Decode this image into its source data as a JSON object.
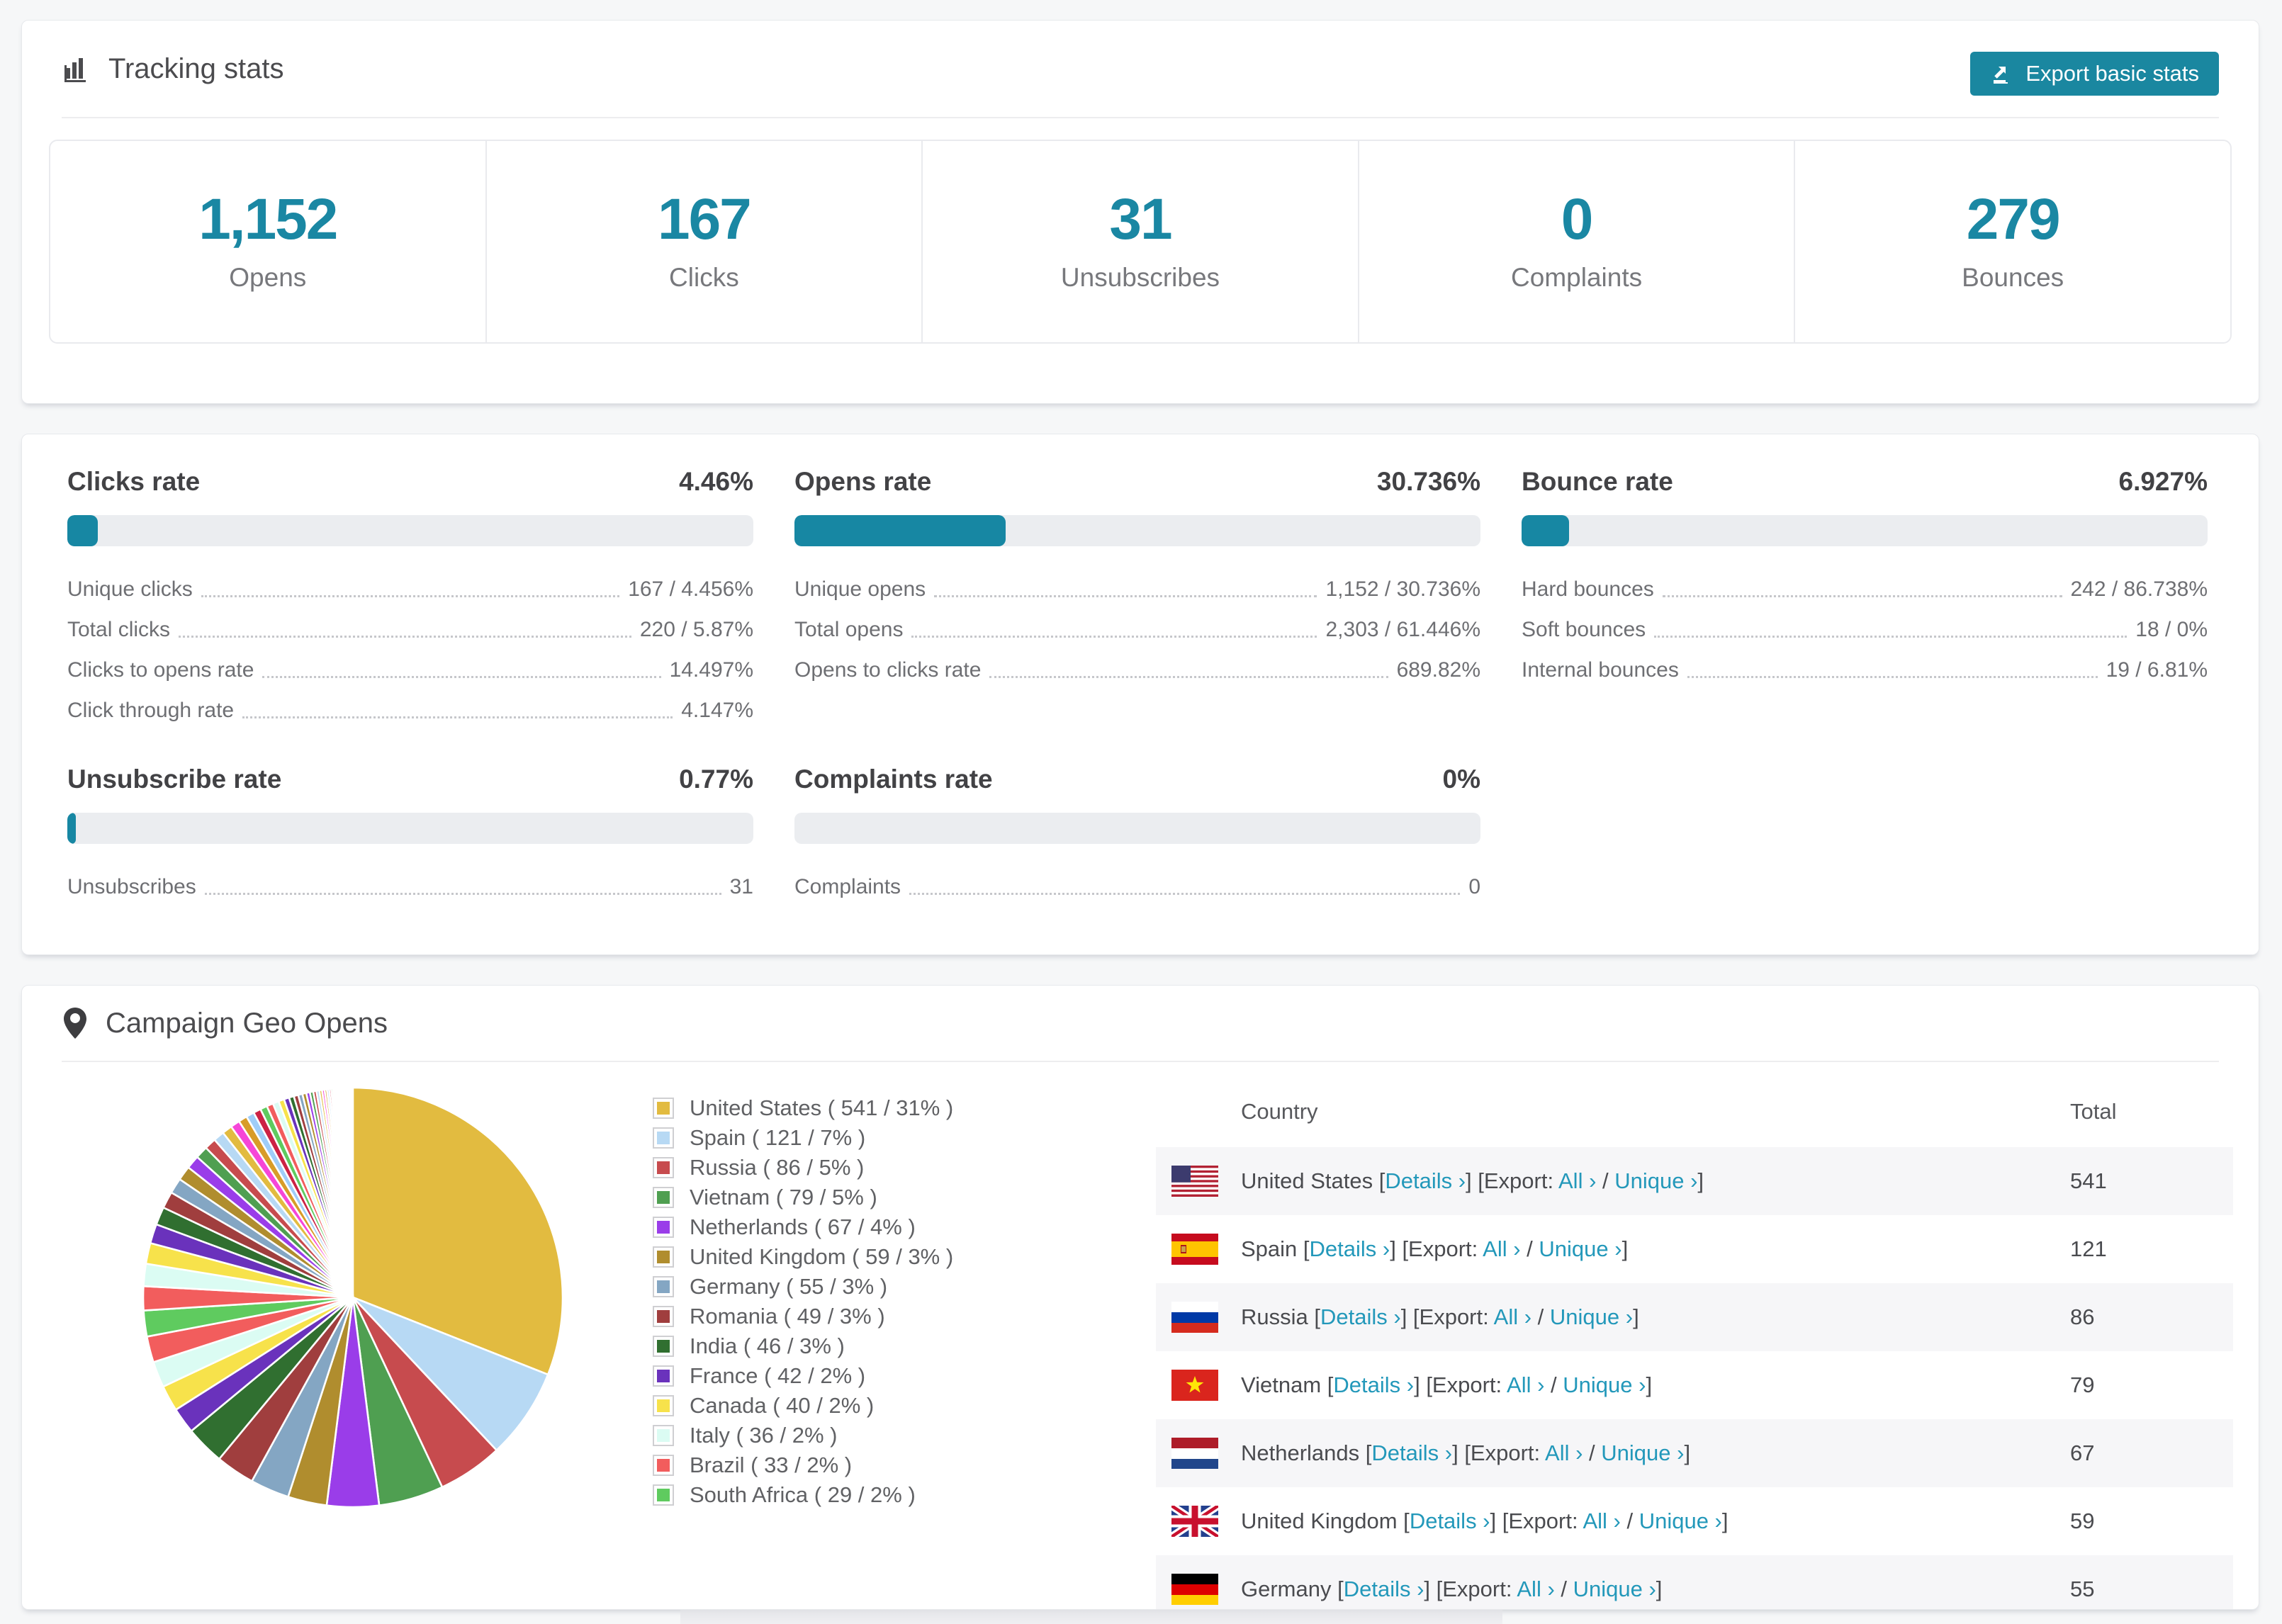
{
  "page": {
    "background": "#f6f7f8",
    "accent": "#1a87a0",
    "link_color": "#2398ba"
  },
  "tracking": {
    "title": "Tracking stats",
    "title_icon": "bar-chart-icon",
    "export_button": {
      "label": "Export basic stats",
      "icon": "export-icon",
      "bg": "#1a87a0"
    },
    "stats": [
      {
        "value": "1,152",
        "label": "Opens"
      },
      {
        "value": "167",
        "label": "Clicks"
      },
      {
        "value": "31",
        "label": "Unsubscribes"
      },
      {
        "value": "0",
        "label": "Complaints"
      },
      {
        "value": "279",
        "label": "Bounces"
      }
    ]
  },
  "rates": {
    "sections": [
      {
        "title": "Clicks rate",
        "value": "4.46%",
        "bar_pct": 4.46,
        "rows": [
          [
            "Unique clicks",
            "167 / 4.456%"
          ],
          [
            "Total clicks",
            "220 / 5.87%"
          ],
          [
            "Clicks to opens rate",
            "14.497%"
          ],
          [
            "Click through rate",
            "4.147%"
          ]
        ]
      },
      {
        "title": "Opens rate",
        "value": "30.736%",
        "bar_pct": 30.736,
        "rows": [
          [
            "Unique opens",
            "1,152 / 30.736%"
          ],
          [
            "Total opens",
            "2,303 / 61.446%"
          ],
          [
            "Opens to clicks rate",
            "689.82%"
          ]
        ]
      },
      {
        "title": "Bounce rate",
        "value": "6.927%",
        "bar_pct": 6.927,
        "rows": [
          [
            "Hard bounces",
            "242 / 86.738%"
          ],
          [
            "Soft bounces",
            "18 / 0%"
          ],
          [
            "Internal bounces",
            "19 / 6.81%"
          ]
        ]
      },
      {
        "title": "Unsubscribe rate",
        "value": "0.77%",
        "bar_pct": 0.77,
        "rows": [
          [
            "Unsubscribes",
            "31"
          ]
        ]
      },
      {
        "title": "Complaints rate",
        "value": "0%",
        "bar_pct": 0,
        "rows": [
          [
            "Complaints",
            "0"
          ]
        ]
      }
    ]
  },
  "geo": {
    "title": "Campaign Geo Opens",
    "title_icon": "map-pin-icon",
    "legend_format": "{label} ( {value} / {pct}% )",
    "table": {
      "headers": [
        "Country",
        "Total"
      ],
      "link_labels": {
        "details": "Details ›",
        "export_prefix": "Export:",
        "all": "All ›",
        "unique": "Unique ›"
      },
      "rows": [
        {
          "country": "United States",
          "flag": "us",
          "total": "541"
        },
        {
          "country": "Spain",
          "flag": "es",
          "total": "121"
        },
        {
          "country": "Russia",
          "flag": "ru",
          "total": "86"
        },
        {
          "country": "Vietnam",
          "flag": "vn",
          "total": "79"
        },
        {
          "country": "Netherlands",
          "flag": "nl",
          "total": "67"
        },
        {
          "country": "United Kingdom",
          "flag": "gb",
          "total": "59"
        },
        {
          "country": "Germany",
          "flag": "de",
          "total": "55",
          "clipped": true
        }
      ]
    }
  },
  "chart_data": {
    "type": "pie",
    "title": "Campaign Geo Opens",
    "legend_position": "right",
    "start_angle_deg": -90,
    "direction": "clockwise",
    "slices": [
      {
        "label": "United States",
        "value": 541,
        "pct": 31,
        "color": "#e2bb40"
      },
      {
        "label": "Spain",
        "value": 121,
        "pct": 7,
        "color": "#b7d9f4"
      },
      {
        "label": "Russia",
        "value": 86,
        "pct": 5,
        "color": "#c74b4e"
      },
      {
        "label": "Vietnam",
        "value": 79,
        "pct": 5,
        "color": "#4f9f51"
      },
      {
        "label": "Netherlands",
        "value": 67,
        "pct": 4,
        "color": "#9a3de9"
      },
      {
        "label": "United Kingdom",
        "value": 59,
        "pct": 3,
        "color": "#b08d2e"
      },
      {
        "label": "Germany",
        "value": 55,
        "pct": 3,
        "color": "#84a6c3"
      },
      {
        "label": "Romania",
        "value": 49,
        "pct": 3,
        "color": "#a03e3e"
      },
      {
        "label": "India",
        "value": 46,
        "pct": 3,
        "color": "#306f30"
      },
      {
        "label": "France",
        "value": 42,
        "pct": 2,
        "color": "#6a32bc"
      },
      {
        "label": "Canada",
        "value": 40,
        "pct": 2,
        "color": "#f7e24b"
      },
      {
        "label": "Italy",
        "value": 36,
        "pct": 2,
        "color": "#dbfcf3"
      },
      {
        "label": "Brazil",
        "value": 33,
        "pct": 2,
        "color": "#f25d5d"
      },
      {
        "label": "South Africa",
        "value": 29,
        "pct": 2,
        "color": "#5fcb5f"
      }
    ],
    "unlabeled_tail": {
      "note": "many small unlabeled countries fading to slivers",
      "total_pct": 25.2,
      "start_pct": 1.85,
      "decay": 0.93,
      "slice_count": 42,
      "palette": [
        "#f25d5d",
        "#dbfcf3",
        "#f7e24b",
        "#6a32bc",
        "#306f30",
        "#a03e3e",
        "#84a6c3",
        "#b08d2e",
        "#9a3de9",
        "#4f9f51",
        "#c74b4e",
        "#b7d9f4",
        "#e2bb40",
        "#f646d8",
        "#d89c28",
        "#9fcdf8",
        "#cc2244",
        "#5fcb5f"
      ]
    }
  }
}
